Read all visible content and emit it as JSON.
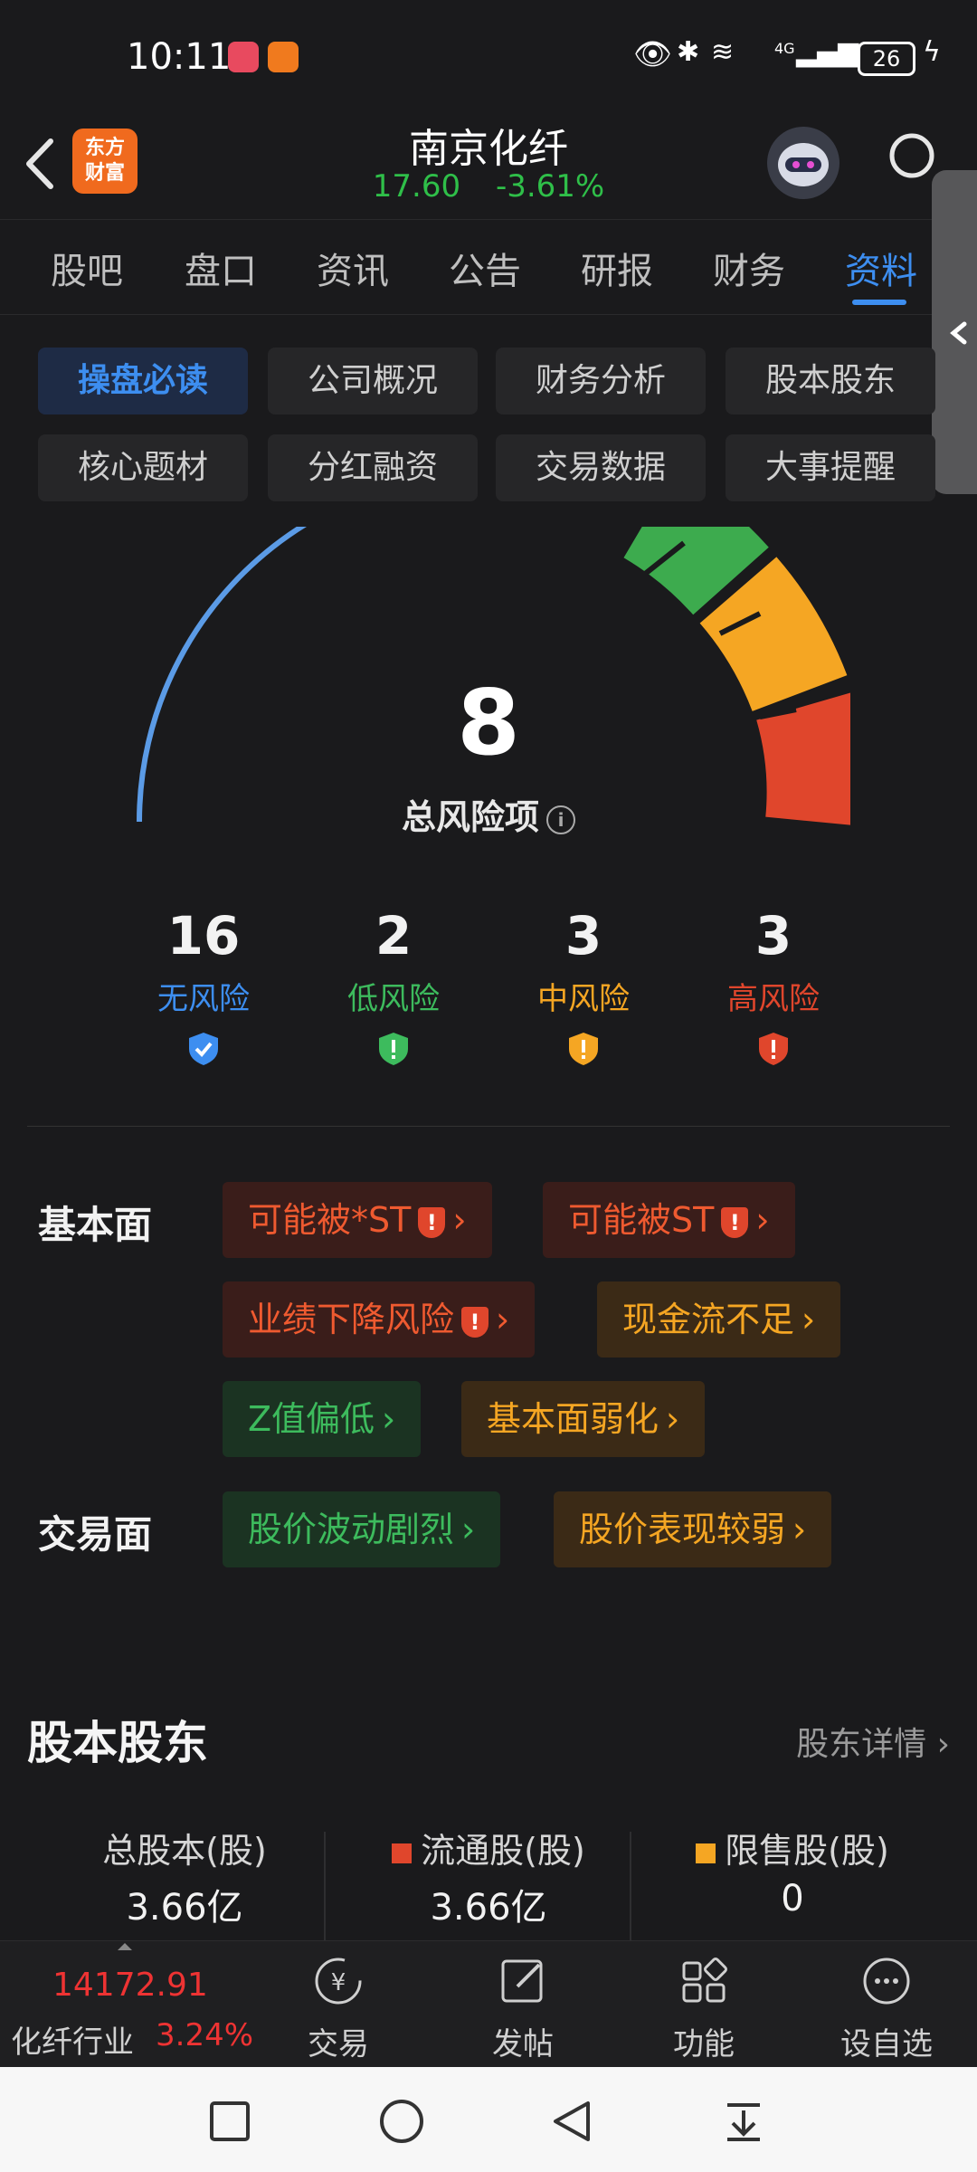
{
  "status_bar": {
    "time": "10:11",
    "network": "4G",
    "battery": "26"
  },
  "header": {
    "logo_text_1": "东方",
    "logo_text_2": "财富",
    "title": "南京化纤",
    "price": "17.60",
    "change": "-3.61%"
  },
  "tabs": [
    "股吧",
    "盘口",
    "资讯",
    "公告",
    "研报",
    "财务",
    "资料"
  ],
  "active_tab": "资料",
  "sub_tabs": [
    "操盘必读",
    "公司概况",
    "财务分析",
    "股本股东",
    "核心题材",
    "分红融资",
    "交易数据",
    "大事提醒"
  ],
  "active_sub_tab": "操盘必读",
  "risk": {
    "total": "8",
    "total_label": "总风险项",
    "counts": [
      {
        "value": "16",
        "label": "无风险",
        "color": "#3d8ef0"
      },
      {
        "value": "2",
        "label": "低风险",
        "color": "#3dbb5d"
      },
      {
        "value": "3",
        "label": "中风险",
        "color": "#f5a623"
      },
      {
        "value": "3",
        "label": "高风险",
        "color": "#e0462c"
      }
    ],
    "fundamental_label": "基本面",
    "fundamental_items": [
      "可能被*ST",
      "可能被ST",
      "业绩下降风险",
      "现金流不足",
      "Z值偏低",
      "基本面弱化"
    ],
    "trading_label": "交易面",
    "trading_items": [
      "股价波动剧烈",
      "股价表现较弱"
    ]
  },
  "shareholders": {
    "title": "股本股东",
    "detail_link": "股东详情",
    "total_label": "总股本(股)",
    "total_value": "3.66亿",
    "float_label": "流通股(股)",
    "float_value": "3.66亿",
    "restricted_label": "限售股(股)",
    "restricted_value": "0"
  },
  "bottom_bar": {
    "industry_value": "14172.91",
    "industry_label": "化纤行业",
    "industry_change": "3.24%",
    "items": [
      "交易",
      "发帖",
      "功能",
      "设自选"
    ]
  },
  "colors": {
    "accent": "#3d8ef0",
    "up": "#e33",
    "down": "#2fbf49"
  }
}
